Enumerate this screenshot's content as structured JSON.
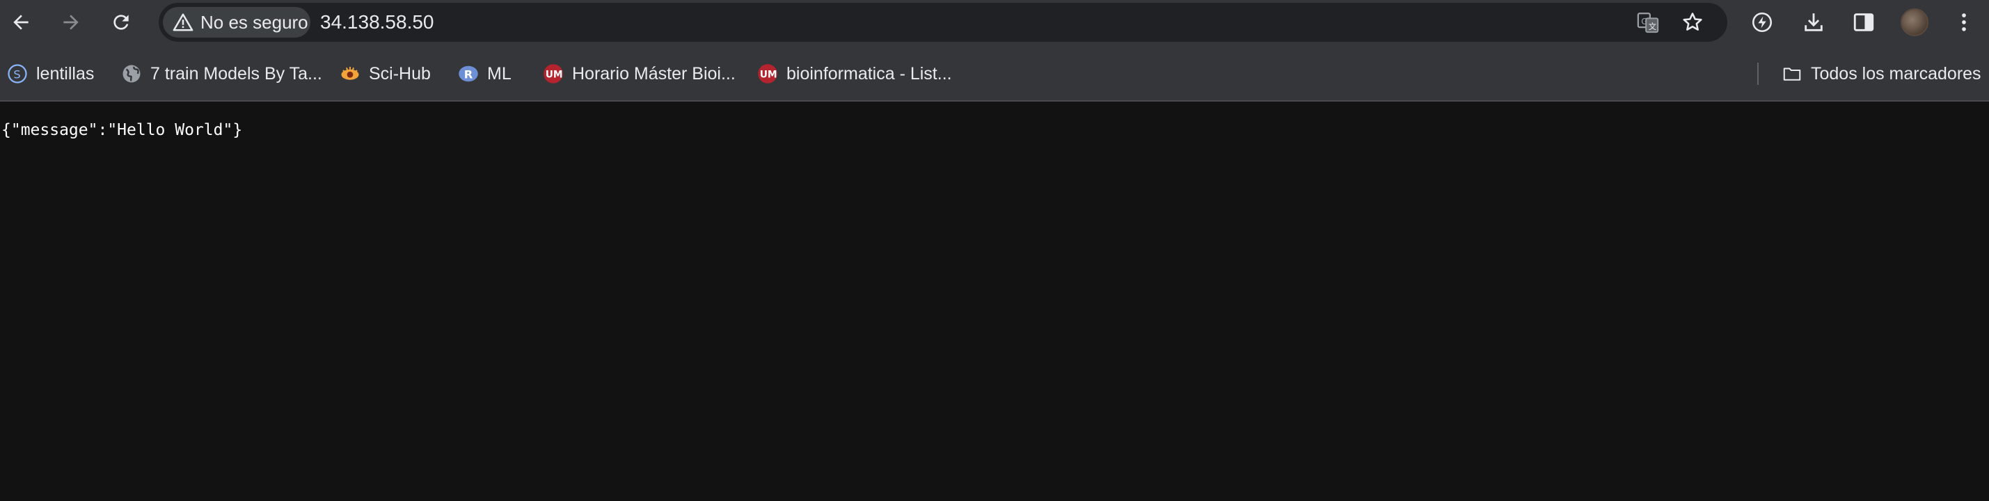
{
  "browser": {
    "security_label": "No es seguro",
    "url": "34.138.58.50",
    "icons": [
      "back-icon",
      "forward-icon",
      "reload-icon",
      "warning-icon",
      "translate-icon",
      "star-icon",
      "performance-icon",
      "download-icon",
      "side-panel-icon",
      "profile-avatar",
      "menu-icon"
    ]
  },
  "bookmarks": {
    "items": [
      {
        "label": "lentillas",
        "icon": "s-circle-icon"
      },
      {
        "label": "7 train Models By Ta...",
        "icon": "globe-icon"
      },
      {
        "label": "Sci-Hub",
        "icon": "scihub-icon"
      },
      {
        "label": "ML",
        "icon": "r-logo-icon"
      },
      {
        "label": "Horario Máster Bioi...",
        "icon": "um-logo-icon"
      },
      {
        "label": "bioinformatica - List...",
        "icon": "um-logo-icon"
      }
    ],
    "all_bookmarks_label": "Todos los marcadores"
  },
  "page": {
    "body_text": "{\"message\":\"Hello World\"}"
  },
  "colors": {
    "toolbar": "#35363a",
    "omnibox": "#202124",
    "page_background": "#121212",
    "text": "#e8eaed",
    "um_red": "#b3242f"
  }
}
